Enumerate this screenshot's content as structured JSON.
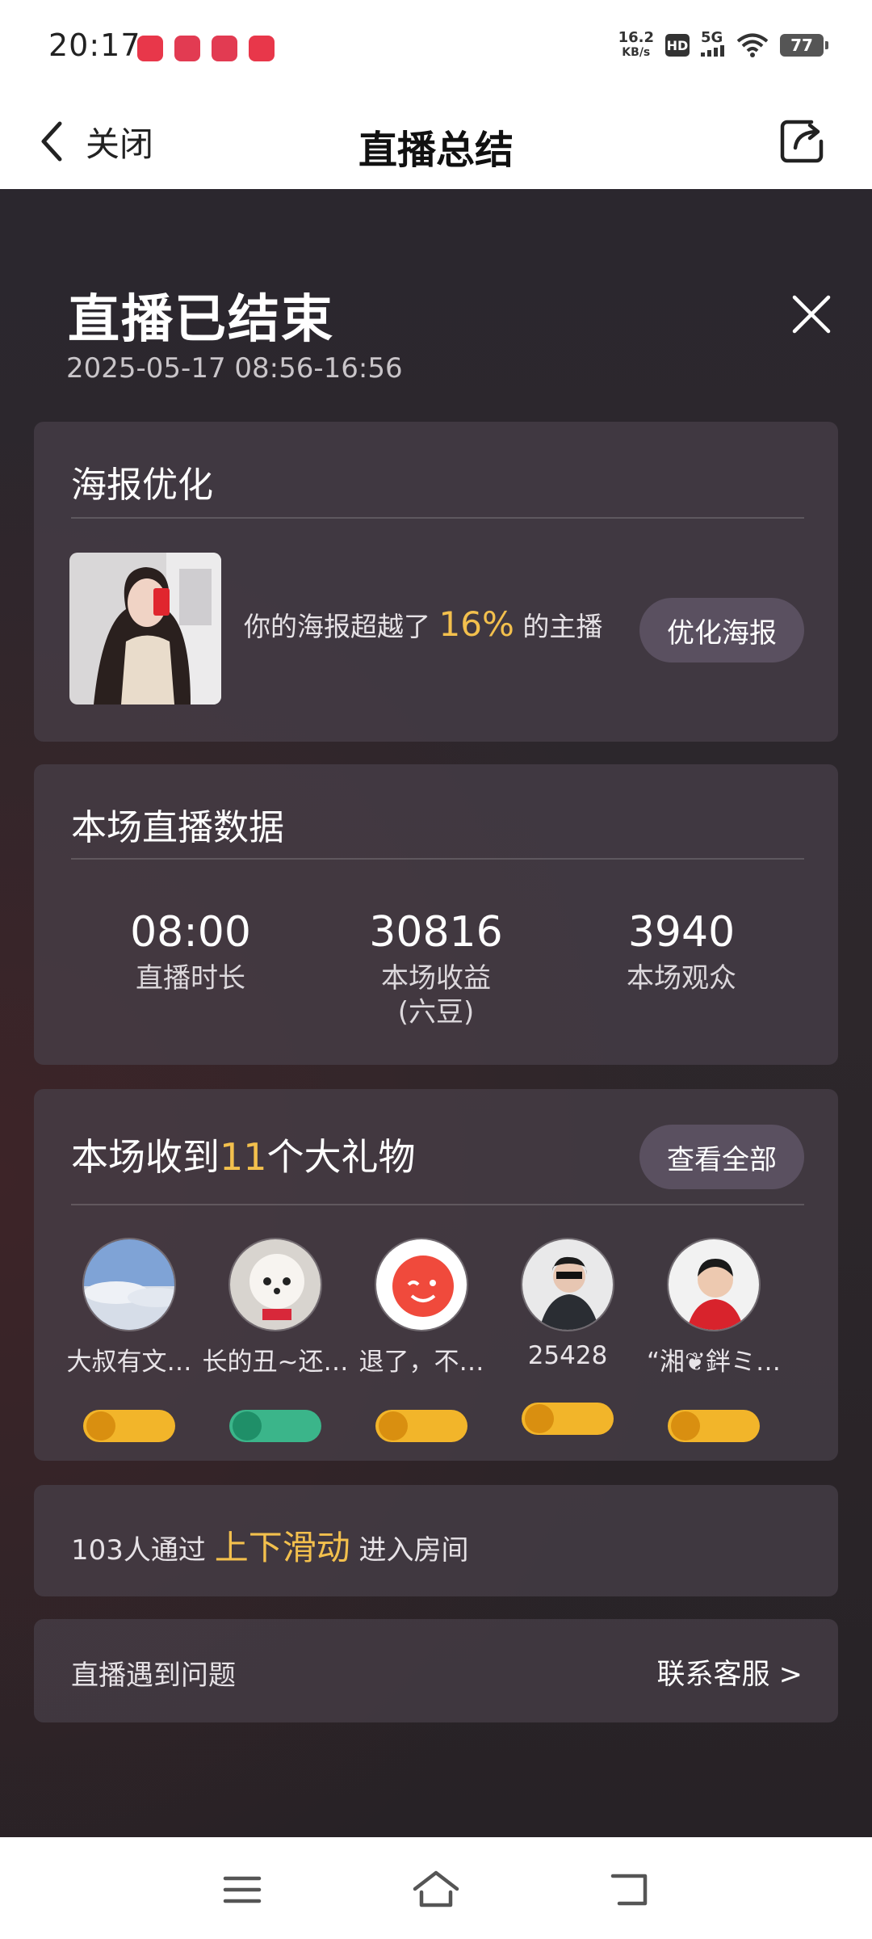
{
  "status_bar": {
    "time": "20:17",
    "net_speed": "16.2",
    "net_speed_unit": "KB/s",
    "hd": "HD",
    "network": "5G",
    "battery": "77"
  },
  "header": {
    "back_label": "关闭",
    "title": "直播总结"
  },
  "summary": {
    "title": "直播已结束",
    "time_range": "2025-05-17 08:56-16:56"
  },
  "poster": {
    "title": "海报优化",
    "text_prefix": "你的海报超越了",
    "percent": "16%",
    "text_suffix": "的主播",
    "button": "优化海报"
  },
  "stats": {
    "title": "本场直播数据",
    "items": [
      {
        "value": "08:00",
        "label": "直播时长",
        "sub": ""
      },
      {
        "value": "30816",
        "label": "本场收益",
        "sub": "(六豆)"
      },
      {
        "value": "3940",
        "label": "本场观众",
        "sub": ""
      }
    ]
  },
  "gifts": {
    "title_prefix": "本场收到",
    "count": "11",
    "title_suffix": "个大礼物",
    "view_all": "查看全部",
    "users": [
      {
        "name": "大叔有文…",
        "badge_color": "#f2b52a"
      },
      {
        "name": "长的丑~还…",
        "badge_color": "#3bb58a"
      },
      {
        "name": "退了，不…",
        "badge_color": "#f2b52a"
      },
      {
        "name": "25428",
        "badge_color": "#f2b52a"
      },
      {
        "name": "“湘❦鉡ミ…",
        "badge_color": "#f2b52a"
      }
    ]
  },
  "slide": {
    "prefix": "103人通过",
    "highlight": "上下滑动",
    "suffix": "进入房间"
  },
  "problem": {
    "text": "直播遇到问题",
    "link": "联系客服 >"
  },
  "colors": {
    "accent": "#f3c04d",
    "card_bg": "#463f49",
    "pill_bg": "#5a5060"
  }
}
